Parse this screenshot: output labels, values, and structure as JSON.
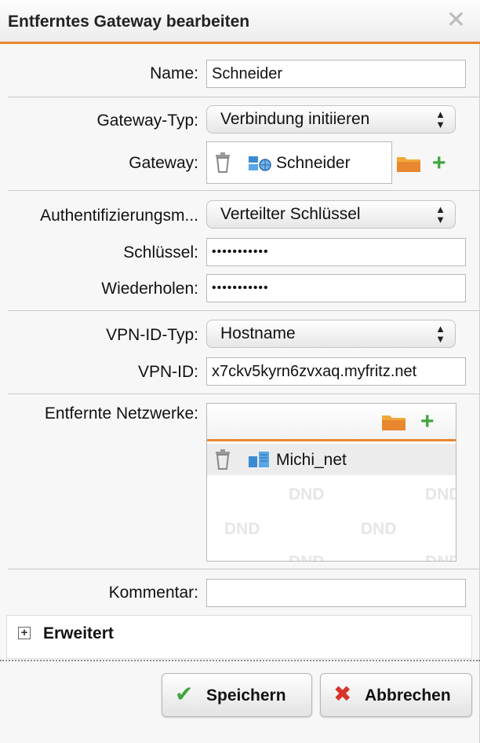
{
  "dialog": {
    "title": "Entferntes Gateway bearbeiten"
  },
  "form": {
    "name": {
      "label": "Name:",
      "value": "Schneider"
    },
    "gateway_type": {
      "label": "Gateway-Typ:",
      "value": "Verbindung initiieren"
    },
    "gateway": {
      "label": "Gateway:",
      "value": "Schneider"
    },
    "auth_method": {
      "label": "Authentifizierungsm...",
      "value": "Verteilter Schlüssel"
    },
    "key": {
      "label": "Schlüssel:",
      "value": "•••••••••••"
    },
    "repeat": {
      "label": "Wiederholen:",
      "value": "•••••••••••"
    },
    "vpn_id_type": {
      "label": "VPN-ID-Typ:",
      "value": "Hostname"
    },
    "vpn_id": {
      "label": "VPN-ID:",
      "value": "x7ckv5kyrn6zvxaq.myfritz.net"
    },
    "remote_networks": {
      "label": "Entfernte Netzwerke:",
      "items": [
        "Michi_net"
      ],
      "drop_hint": "DND"
    },
    "comment": {
      "label": "Kommentar:",
      "value": ""
    }
  },
  "advanced": {
    "label": "Erweitert"
  },
  "buttons": {
    "save": "Speichern",
    "cancel": "Abbrechen"
  },
  "colors": {
    "accent": "#e8872f",
    "add": "#3ea63e",
    "cancel": "#d9342b",
    "save": "#3ea63e"
  }
}
